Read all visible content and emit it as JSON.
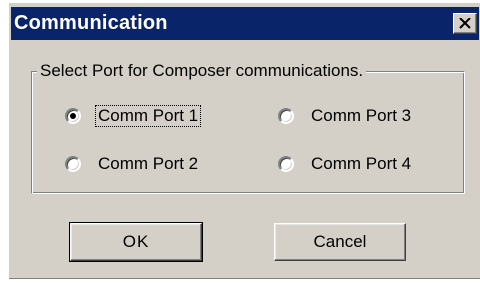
{
  "window": {
    "title": "Communication",
    "close_icon": "close-icon"
  },
  "group": {
    "label": "Select Port for Composer communications."
  },
  "ports": [
    {
      "label": "Comm Port 1",
      "selected": true
    },
    {
      "label": "Comm Port 2",
      "selected": false
    },
    {
      "label": "Comm Port 3",
      "selected": false
    },
    {
      "label": "Comm Port 4",
      "selected": false
    }
  ],
  "buttons": {
    "ok_label": "OK",
    "cancel_label": "Cancel"
  },
  "colors": {
    "titlebar": "#0a246a",
    "face": "#d4d0c8"
  }
}
